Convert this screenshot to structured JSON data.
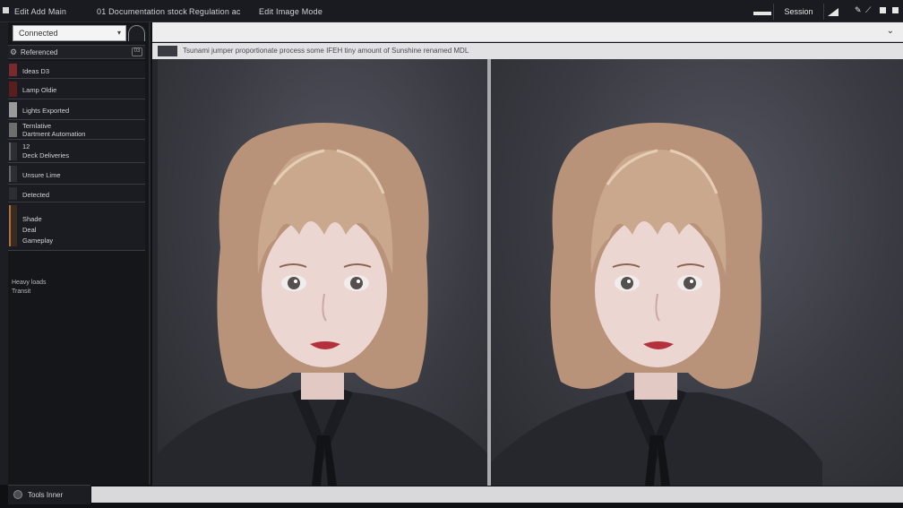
{
  "menu": {
    "items": [
      "Edit Add Main",
      "01 Documentation stock",
      "Regulation ac",
      "Edit Image Mode"
    ]
  },
  "toolbar": {
    "search_label": "Session"
  },
  "sidebar": {
    "combo_value": "Connected",
    "section_title": "Referenced",
    "section_badge": "03",
    "items": [
      {
        "lines": [
          "Ideas D3"
        ]
      },
      {
        "lines": [
          "Lamp Oldie"
        ]
      },
      {
        "lines": [
          "Lights Exported"
        ]
      },
      {
        "lines": [
          "Ternlative",
          "Dartment Automation"
        ]
      },
      {
        "lines": [
          "12",
          "Deck Deliveries"
        ]
      },
      {
        "lines": [
          "Unsure Lime"
        ]
      },
      {
        "lines": [
          "Detected"
        ]
      },
      {
        "lines": [
          "Shade",
          "Deal",
          "Gameplay"
        ]
      }
    ],
    "footer_lines": [
      "Heavy loads",
      "Transit"
    ],
    "bottom_label": "Tools Inner"
  },
  "info_bar": {
    "text": "Tsunami jumper proportionate process some IFEH tiny amount of Sunshine renamed MDL"
  },
  "colors": {
    "topbar_bg": "#1a1b20",
    "sidebar_bg": "#15161a",
    "viewer_bg": "#26272c",
    "hair": "#c8a080",
    "lips": "#b5303d"
  }
}
